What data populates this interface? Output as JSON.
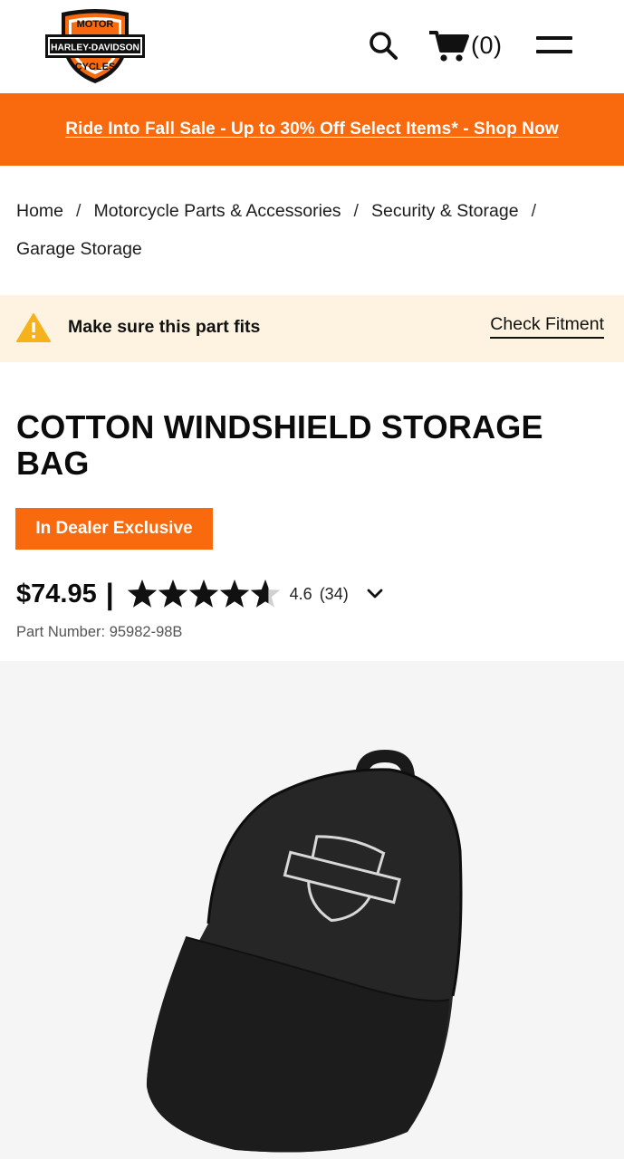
{
  "header": {
    "logo_words": [
      "MOTOR",
      "HARLEY-DAVIDSON",
      "CYCLES"
    ],
    "cart_count": "(0)"
  },
  "promo": {
    "text": "Ride Into Fall Sale - Up to 30% Off Select Items* - Shop Now",
    "color": "#f96a0e"
  },
  "breadcrumb": [
    "Home",
    "Motorcycle Parts & Accessories",
    "Security & Storage",
    "Garage Storage"
  ],
  "breadcrumb_separator": "/",
  "fitment": {
    "message": "Make sure this part fits",
    "link": "Check Fitment"
  },
  "product": {
    "title": "COTTON WINDSHIELD STORAGE BAG",
    "badge": "In Dealer Exclusive",
    "price": "$74.95",
    "separator": "|",
    "rating": "4.6",
    "rating_value": 4.6,
    "rating_max": 5,
    "review_count": "(34)",
    "part_number": "Part Number: 95982-98B"
  },
  "icons": {
    "search": "search-icon",
    "cart": "cart-icon",
    "menu": "menu-icon",
    "warning": "warning-icon",
    "expand": "chevron-down-icon"
  },
  "colors": {
    "brand_orange": "#f96a0e",
    "fitment_bg": "#fdf3e0",
    "image_bg": "#f5f5f5"
  }
}
